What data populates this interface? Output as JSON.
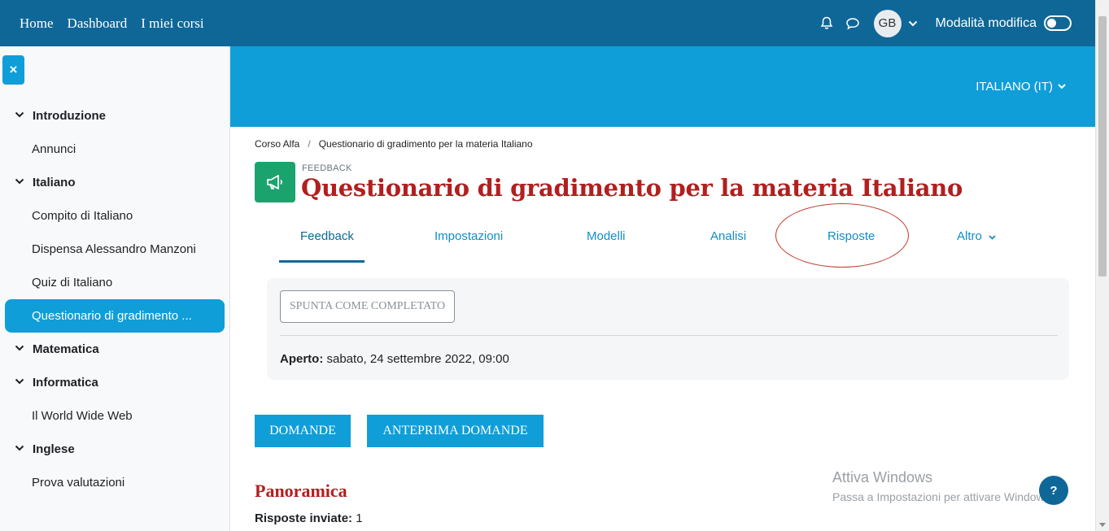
{
  "topnav": {
    "items": [
      "Home",
      "Dashboard",
      "I miei corsi"
    ],
    "avatar_initials": "GB",
    "edit_mode_label": "Modalità modifica"
  },
  "drawer": {
    "close_icon": "×",
    "sections": [
      {
        "label": "Introduzione",
        "activities": [
          "Annunci"
        ]
      },
      {
        "label": "Italiano",
        "activities": [
          "Compito di Italiano",
          "Dispensa Alessandro Manzoni",
          "Quiz di Italiano",
          "Questionario di gradimento ..."
        ]
      },
      {
        "label": "Matematica",
        "activities": []
      },
      {
        "label": "Informatica",
        "activities": [
          "Il World Wide Web"
        ]
      },
      {
        "label": "Inglese",
        "activities": [
          "Prova valutazioni"
        ]
      }
    ]
  },
  "hero": {
    "language": "ITALIANO (IT)"
  },
  "breadcrumb": {
    "course": "Corso Alfa",
    "separator": "/",
    "current": "Questionario di gradimento per la materia Italiano"
  },
  "activity": {
    "type": "FEEDBACK",
    "title": "Questionario di gradimento per la materia Italiano",
    "icon": "megaphone-icon",
    "icon_color": "#1ba36e"
  },
  "tabs": [
    "Feedback",
    "Impostazioni",
    "Modelli",
    "Analisi",
    "Risposte",
    "Altro"
  ],
  "completion": {
    "button": "SPUNTA COME COMPLETATO",
    "open_label": "Aperto:",
    "open_value": " sabato, 24 settembre 2022, 09:00"
  },
  "buttons": {
    "questions": "DOMANDE",
    "preview": "ANTEPRIMA DOMANDE"
  },
  "overview": {
    "title": "Panoramica",
    "responses_label": "Risposte inviate:",
    "responses_value": " 1"
  },
  "watermark": {
    "line1": "Attiva Windows",
    "line2": "Passa a Impostazioni per attivare Windows."
  },
  "help": "?",
  "colors": {
    "navbar": "#0f6797",
    "accent": "#0f9ed8",
    "title": "#b21f1f",
    "annotation": "#c0392b"
  }
}
